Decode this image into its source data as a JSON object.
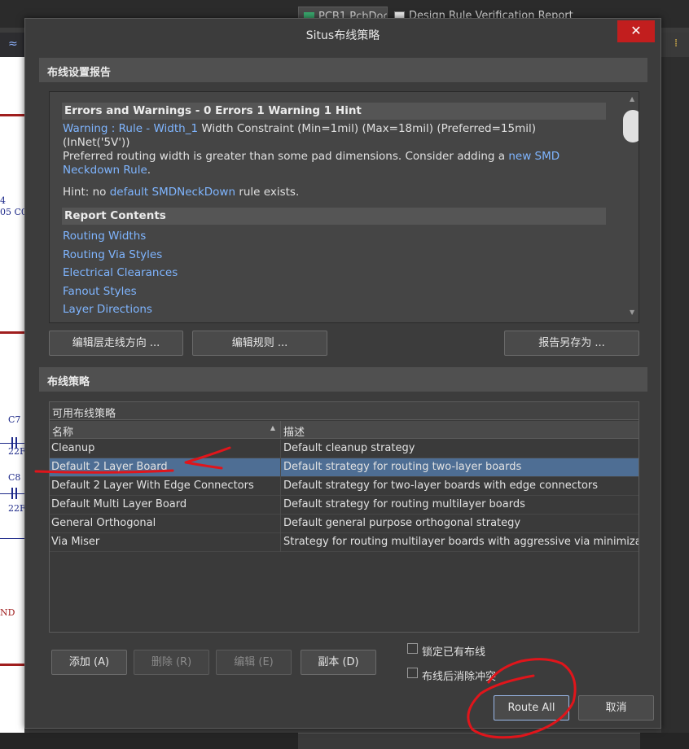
{
  "background": {
    "tabs": [
      {
        "label": "PCB1.PcbDoc"
      },
      {
        "label": "Design Rule Verification Report"
      }
    ],
    "left_labels": [
      "4",
      "05 C0",
      "C7",
      "22F",
      "C8",
      "22F",
      "ND"
    ],
    "left_toolbar_icon": "≈",
    "right_toolbar_icon": "⁞"
  },
  "dialog": {
    "title": "Situs布线策略",
    "close_icon": "✕",
    "report_section": {
      "header": "布线设置报告",
      "errors_heading": "Errors and Warnings - 0 Errors 1 Warning 1 Hint",
      "warning_link": "Warning : Rule - Width_1",
      "warning_text": "Width Constraint (Min=1mil) (Max=18mil) (Preferred=15mil)",
      "warning_text2": "(InNet('5V'))",
      "pref_text": "Preferred routing width is greater than some pad dimensions. Consider adding a",
      "pref_link1": "new SMD",
      "pref_link2": "Neckdown Rule",
      "pref_end": ".",
      "hint_prefix": "Hint: no",
      "hint_link": "default SMDNeckDown",
      "hint_suffix": "rule exists.",
      "contents_heading": "Report Contents",
      "contents_links": [
        "Routing Widths",
        "Routing Via Styles",
        "Electrical Clearances",
        "Fanout Styles",
        "Layer Directions"
      ]
    },
    "report_buttons": {
      "edit_layer_dir": "编辑层走线方向 ...",
      "edit_rules": "编辑规则 ...",
      "save_report": "报告另存为 ..."
    },
    "strategy_section": {
      "header": "布线策略",
      "group_label": "可用布线策略",
      "col_name": "名称",
      "col_desc": "描述",
      "rows": [
        {
          "name": "Cleanup",
          "desc": "Default cleanup strategy"
        },
        {
          "name": "Default 2 Layer Board",
          "desc": "Default strategy for routing two-layer boards"
        },
        {
          "name": "Default 2 Layer With Edge Connectors",
          "desc": "Default strategy for two-layer boards with edge connectors"
        },
        {
          "name": "Default Multi Layer Board",
          "desc": "Default strategy for routing multilayer boards"
        },
        {
          "name": "General Orthogonal",
          "desc": "Default general purpose orthogonal strategy"
        },
        {
          "name": "Via Miser",
          "desc": "Strategy for routing multilayer boards with aggressive via minimization"
        }
      ],
      "selected_row": "Default 2 Layer Board"
    },
    "strategy_buttons": {
      "add": "添加 (A)",
      "remove": "删除 (R)",
      "edit": "编辑 (E)",
      "copy": "副本 (D)"
    },
    "checkboxes": {
      "lock_routes": "锁定已有布线",
      "clear_conflicts": "布线后消除冲突"
    },
    "footer_buttons": {
      "route_all": "Route All",
      "cancel": "取消"
    },
    "colors": {
      "selected_row": "#4e6e94",
      "link": "#7fb5ff",
      "close": "#c21e1e",
      "annotation": "#e0151b"
    }
  }
}
